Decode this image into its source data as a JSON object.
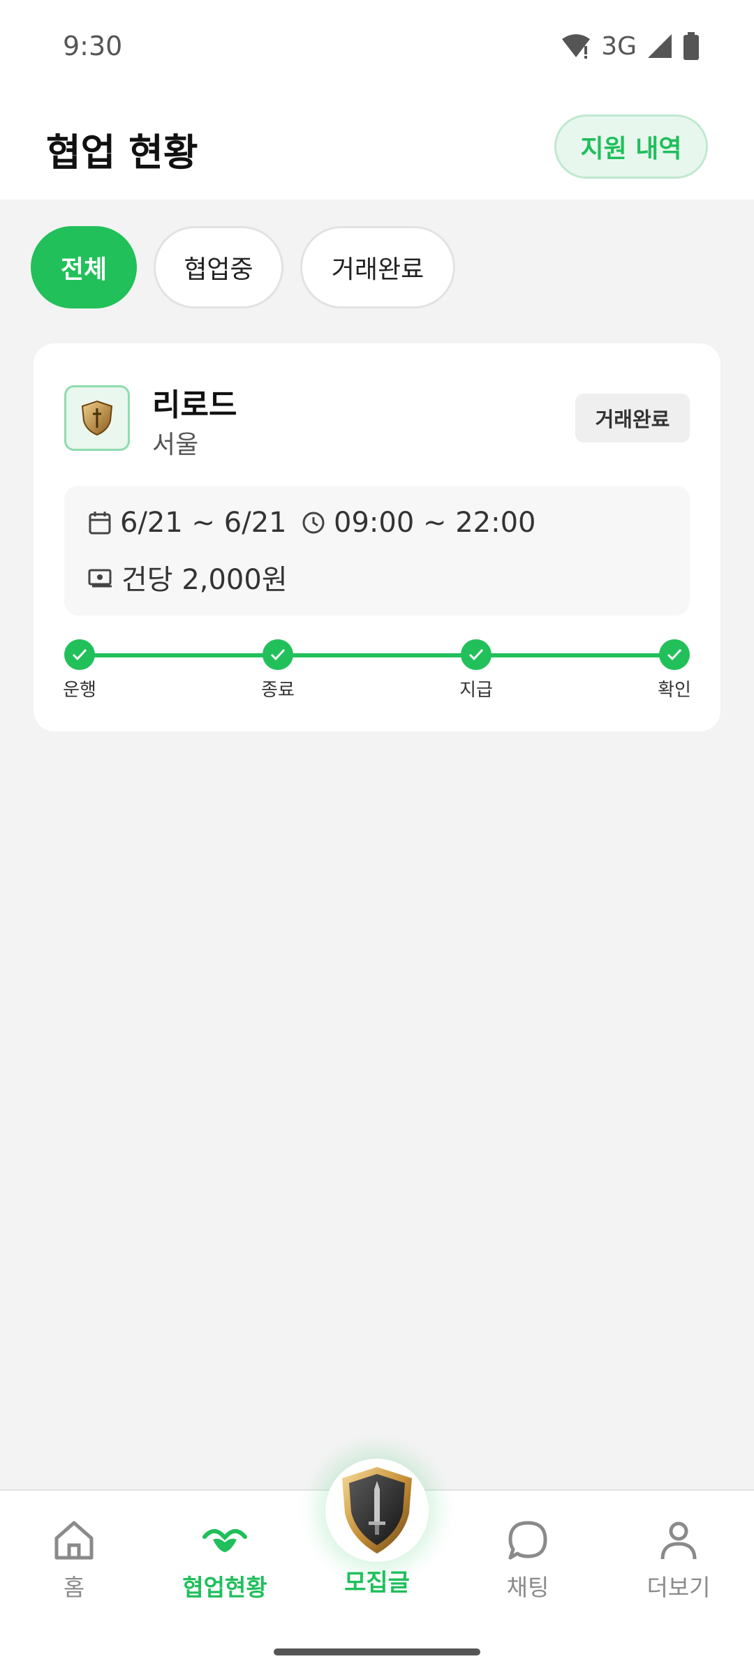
{
  "status_bar": {
    "time": "9:30",
    "network": "3G"
  },
  "header": {
    "title": "협업 현황",
    "history_button": "지원 내역"
  },
  "filters": [
    {
      "label": "전체",
      "active": true
    },
    {
      "label": "협업중",
      "active": false
    },
    {
      "label": "거래완료",
      "active": false
    }
  ],
  "card": {
    "name": "리로드",
    "location": "서울",
    "status": "거래완료",
    "date_range": "6/21 ~ 6/21",
    "time_range": "09:00 ~ 22:00",
    "price": "건당 2,000원",
    "steps": [
      {
        "label": "운행",
        "done": true
      },
      {
        "label": "종료",
        "done": true
      },
      {
        "label": "지급",
        "done": true
      },
      {
        "label": "확인",
        "done": true
      }
    ]
  },
  "bottom_nav": {
    "items": [
      {
        "label": "홈",
        "icon": "home-icon",
        "active": false
      },
      {
        "label": "협업현황",
        "icon": "handshake-icon",
        "active": true
      },
      {
        "label": "모집글",
        "icon": "shield-sword-icon",
        "active": false
      },
      {
        "label": "채팅",
        "icon": "chat-bubble-icon",
        "active": false
      },
      {
        "label": "더보기",
        "icon": "person-icon",
        "active": false
      }
    ]
  },
  "colors": {
    "accent": "#22c05a",
    "background": "#f3f3f3"
  }
}
